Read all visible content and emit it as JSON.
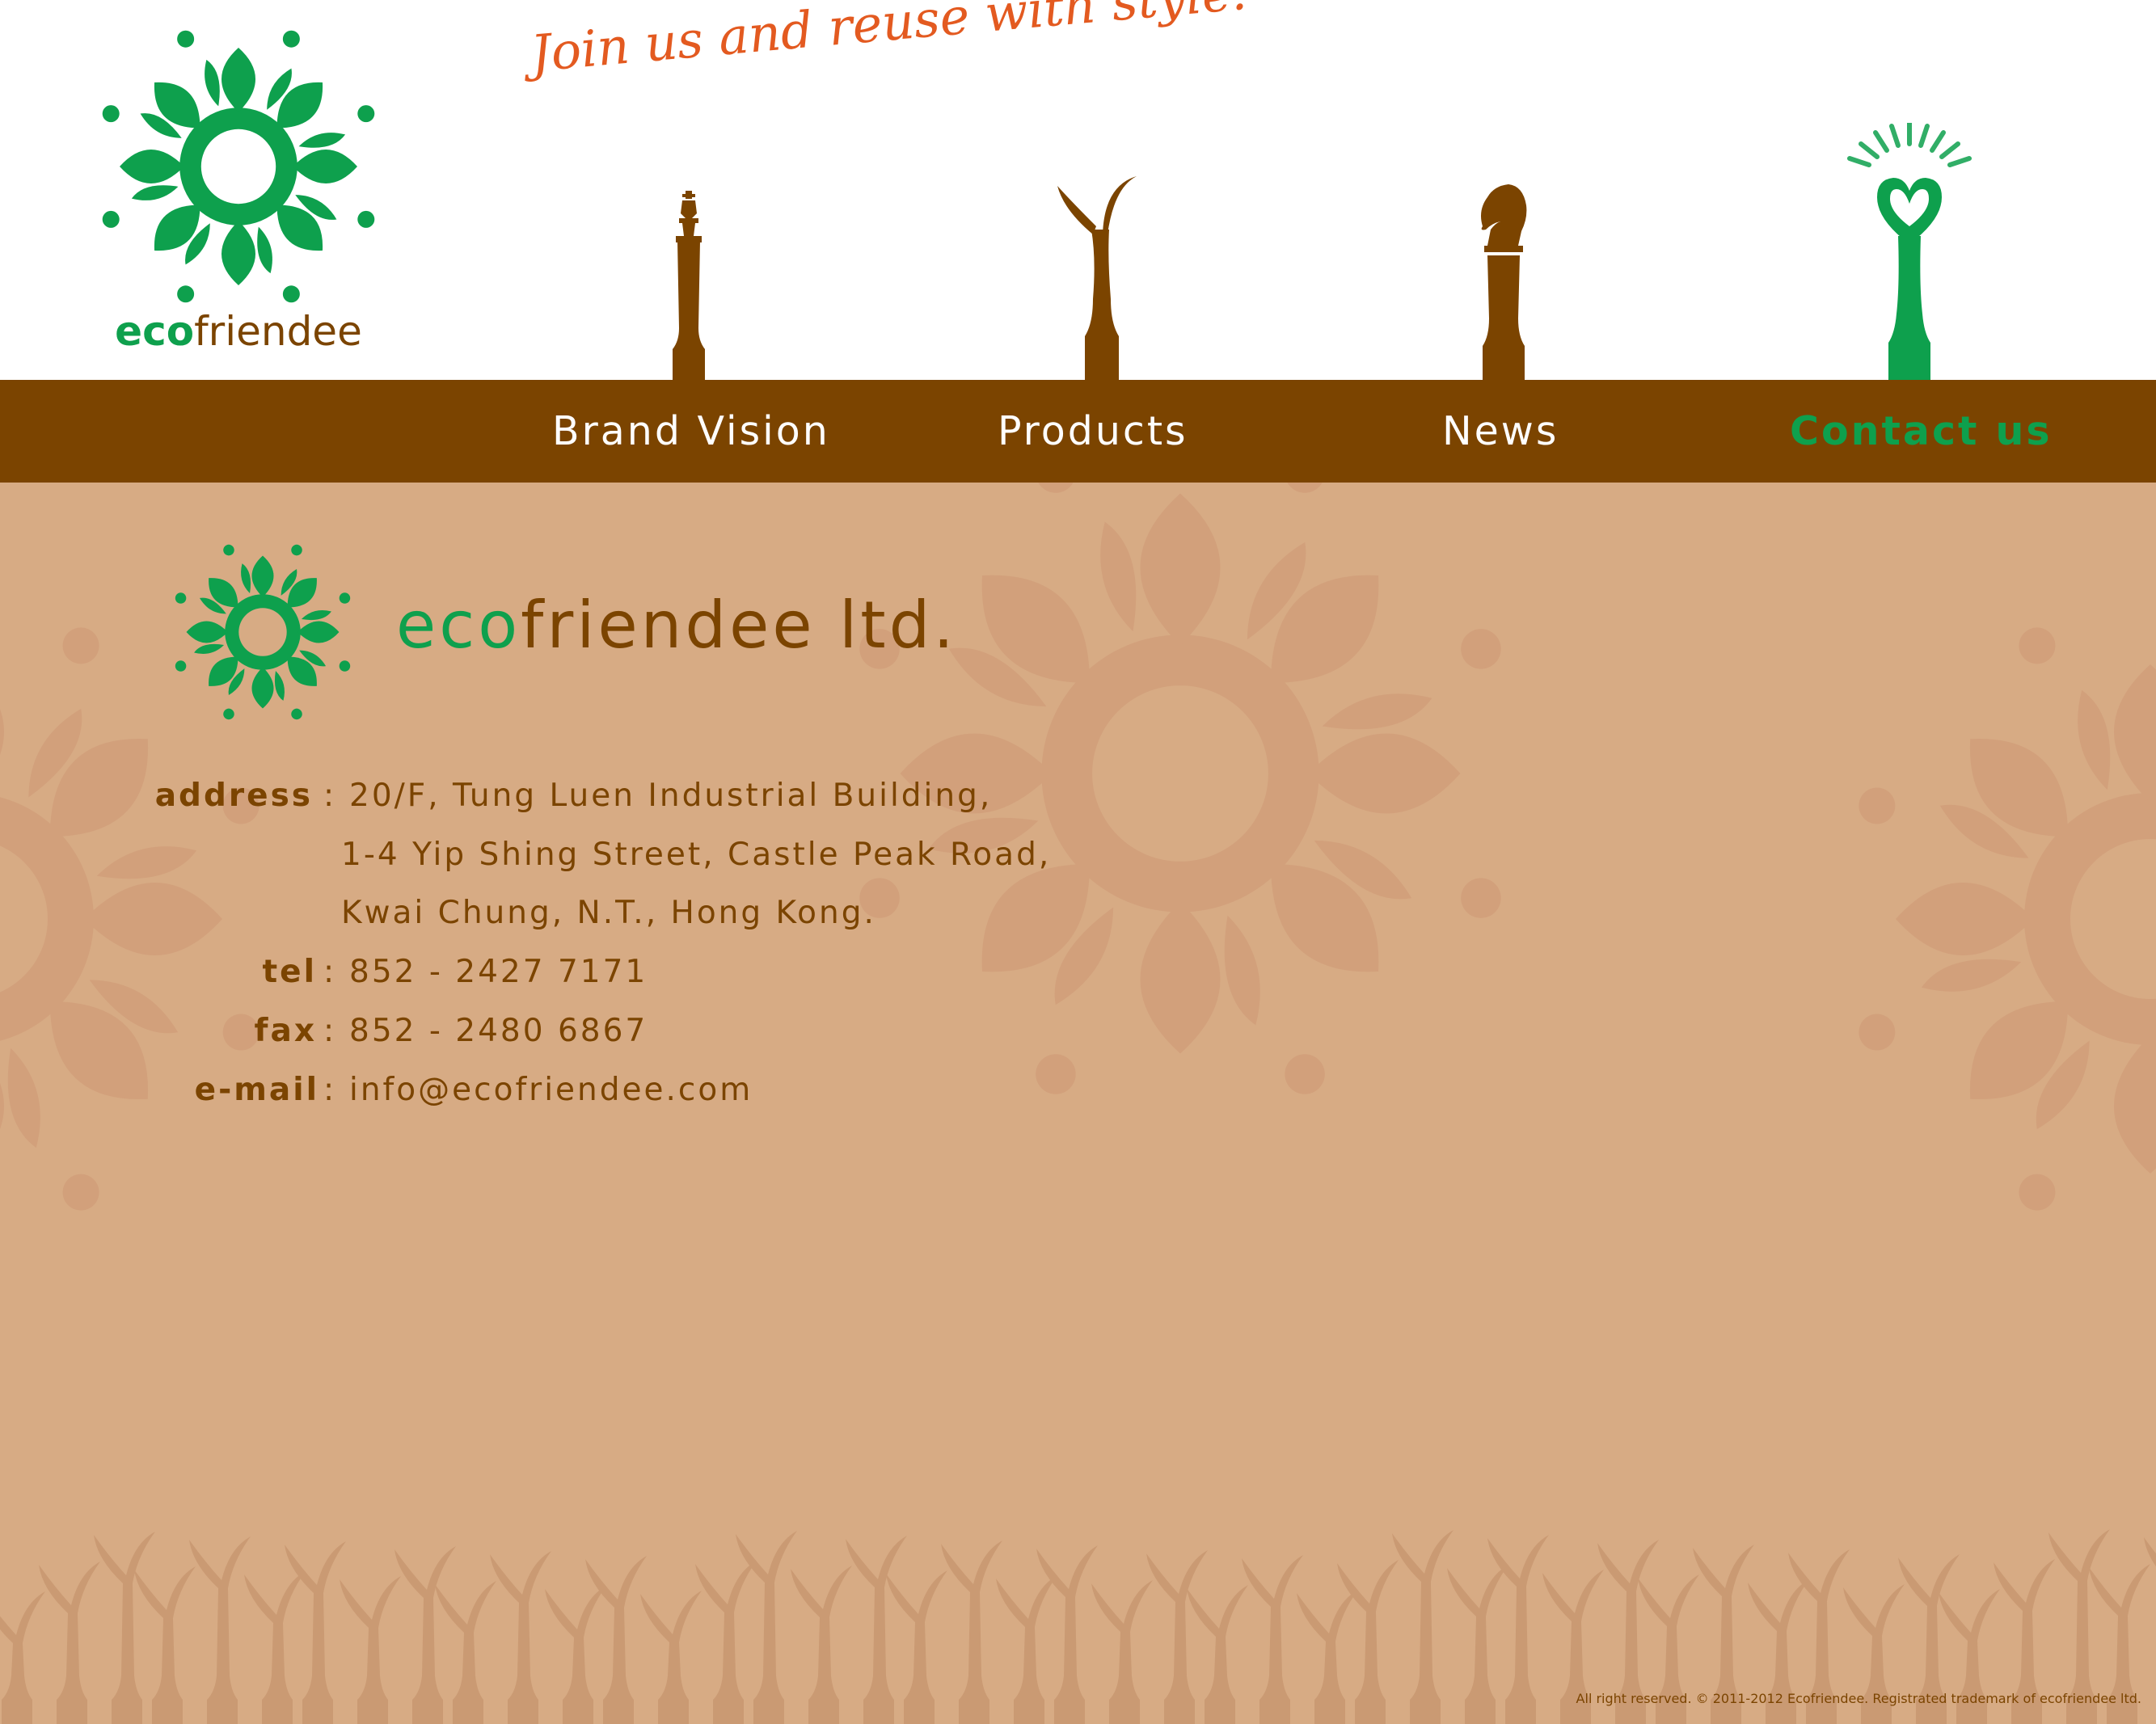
{
  "brand": {
    "wordmark_eco": "eco",
    "wordmark_rest": "friendee"
  },
  "tagline": "Join us and reuse with style!",
  "nav": {
    "items": [
      {
        "label": "Brand Vision"
      },
      {
        "label": "Products"
      },
      {
        "label": "News"
      },
      {
        "label": "Contact us",
        "active": true
      }
    ]
  },
  "company": {
    "name_eco": "eco",
    "name_rest": "friendee ltd."
  },
  "contact": {
    "address_label": "address",
    "address_line1": "20/F, Tung Luen Industrial Building,",
    "address_line2": "1-4 Yip Shing Street, Castle Peak Road,",
    "address_line3": "Kwai Chung, N.T., Hong Kong.",
    "tel_label": "tel",
    "tel": "852 - 2427 7171",
    "fax_label": "fax",
    "fax": "852 - 2480 6867",
    "email_label": "e-mail",
    "email": "info@ecofriendee.com",
    "separator": ":"
  },
  "footer": "All right reserved. © 2011-2012 Ecofriendee. Registrated trademark of ecofriendee ltd.",
  "colors": {
    "brown": "#7b4400",
    "green": "#0ea04d",
    "tan": "#d7ab84",
    "orange": "#e35a20"
  },
  "icons": [
    "flower-logo-icon",
    "king-pillar-icon",
    "sprout-pillar-icon",
    "knight-pillar-icon",
    "heart-pillar-icon"
  ]
}
